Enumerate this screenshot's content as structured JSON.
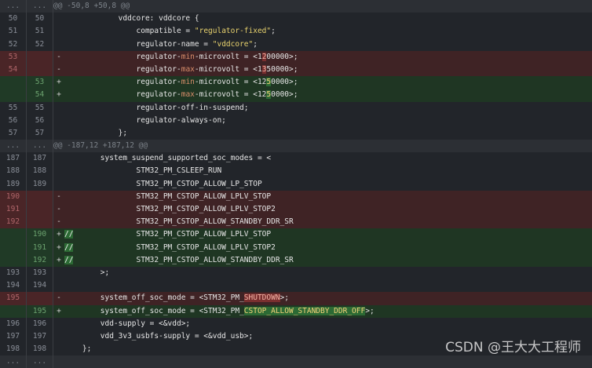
{
  "hunk1": "@@ -50,8 +50,8 @@",
  "hunk2": "@@ -187,12 +187,12 @@",
  "ellipsis": "...",
  "watermark": "CSDN @王大大工程师",
  "lines": {
    "l50": {
      "old": "50",
      "new": "50",
      "pre": "            vddcore: vddcore {"
    },
    "l51": {
      "old": "51",
      "new": "51",
      "pre": "                compatible = ",
      "str": "\"regulator-fixed\"",
      "post": ";"
    },
    "l52": {
      "old": "52",
      "new": "52",
      "pre": "                regulator-name = ",
      "str": "\"vddcore\"",
      "post": ";"
    },
    "d53": {
      "old": "53",
      "sign": "-",
      "pre": "                regulator-",
      "kw": "min",
      "mid": "-microvolt = <1",
      "hl": "2",
      "post": "00000>;"
    },
    "d54": {
      "old": "54",
      "sign": "-",
      "pre": "                regulator-",
      "kw": "max",
      "mid": "-microvolt = <1",
      "hl": "3",
      "post": "50000>;"
    },
    "a53": {
      "new": "53",
      "sign": "+",
      "pre": "                regulator-",
      "kw": "min",
      "mid": "-microvolt = <12",
      "hl": "5",
      "post": "0000>;"
    },
    "a54": {
      "new": "54",
      "sign": "+",
      "pre": "                regulator-",
      "kw": "max",
      "mid": "-microvolt = <12",
      "hl": "5",
      "post": "0000>;"
    },
    "l55": {
      "old": "55",
      "new": "55",
      "pre": "                regulator-off-in-suspend;"
    },
    "l56": {
      "old": "56",
      "new": "56",
      "pre": "                regulator-always-on;"
    },
    "l57": {
      "old": "57",
      "new": "57",
      "pre": "            };"
    },
    "l187": {
      "old": "187",
      "new": "187",
      "pre": "        system_suspend_supported_soc_modes = <"
    },
    "l188": {
      "old": "188",
      "new": "188",
      "pre": "                STM32_PM_CSLEEP_RUN"
    },
    "l189": {
      "old": "189",
      "new": "189",
      "pre": "                STM32_PM_CSTOP_ALLOW_LP_STOP"
    },
    "d190": {
      "old": "190",
      "sign": "-",
      "pre": "                STM32_PM_CSTOP_ALLOW_LPLV_STOP"
    },
    "d191": {
      "old": "191",
      "sign": "-",
      "pre": "                STM32_PM_CSTOP_ALLOW_LPLV_STOP2"
    },
    "d192": {
      "old": "192",
      "sign": "-",
      "pre": "                STM32_PM_CSTOP_ALLOW_STANDBY_DDR_SR"
    },
    "a190": {
      "new": "190",
      "sign": "+",
      "cm": "//",
      "pre": "              STM32_PM_CSTOP_ALLOW_LPLV_STOP"
    },
    "a191": {
      "new": "191",
      "sign": "+",
      "cm": "//",
      "pre": "              STM32_PM_CSTOP_ALLOW_LPLV_STOP2"
    },
    "a192": {
      "new": "192",
      "sign": "+",
      "cm": "//",
      "pre": "              STM32_PM_CSTOP_ALLOW_STANDBY_DDR_SR"
    },
    "l193": {
      "old": "193",
      "new": "193",
      "pre": "        >;"
    },
    "l194": {
      "old": "194",
      "new": "194",
      "pre": ""
    },
    "d195": {
      "old": "195",
      "sign": "-",
      "pre": "        system_off_soc_mode = <STM32_PM_",
      "hl": "SHUTDOWN",
      "post": ">;"
    },
    "a195": {
      "new": "195",
      "sign": "+",
      "pre": "        system_off_soc_mode = <STM32_PM_",
      "hl": "CSTOP_ALLOW_STANDBY_DDR_OFF",
      "post": ">;"
    },
    "l196": {
      "old": "196",
      "new": "196",
      "pre": "        vdd-supply = <&vdd>;"
    },
    "l197": {
      "old": "197",
      "new": "197",
      "pre": "        vdd_3v3_usbfs-supply = <&vdd_usb>;"
    },
    "l198": {
      "old": "198",
      "new": "198",
      "pre": "    };"
    }
  },
  "colors": {
    "deleted": "#3f2325",
    "added": "#1f3623",
    "context": "#22252a"
  }
}
